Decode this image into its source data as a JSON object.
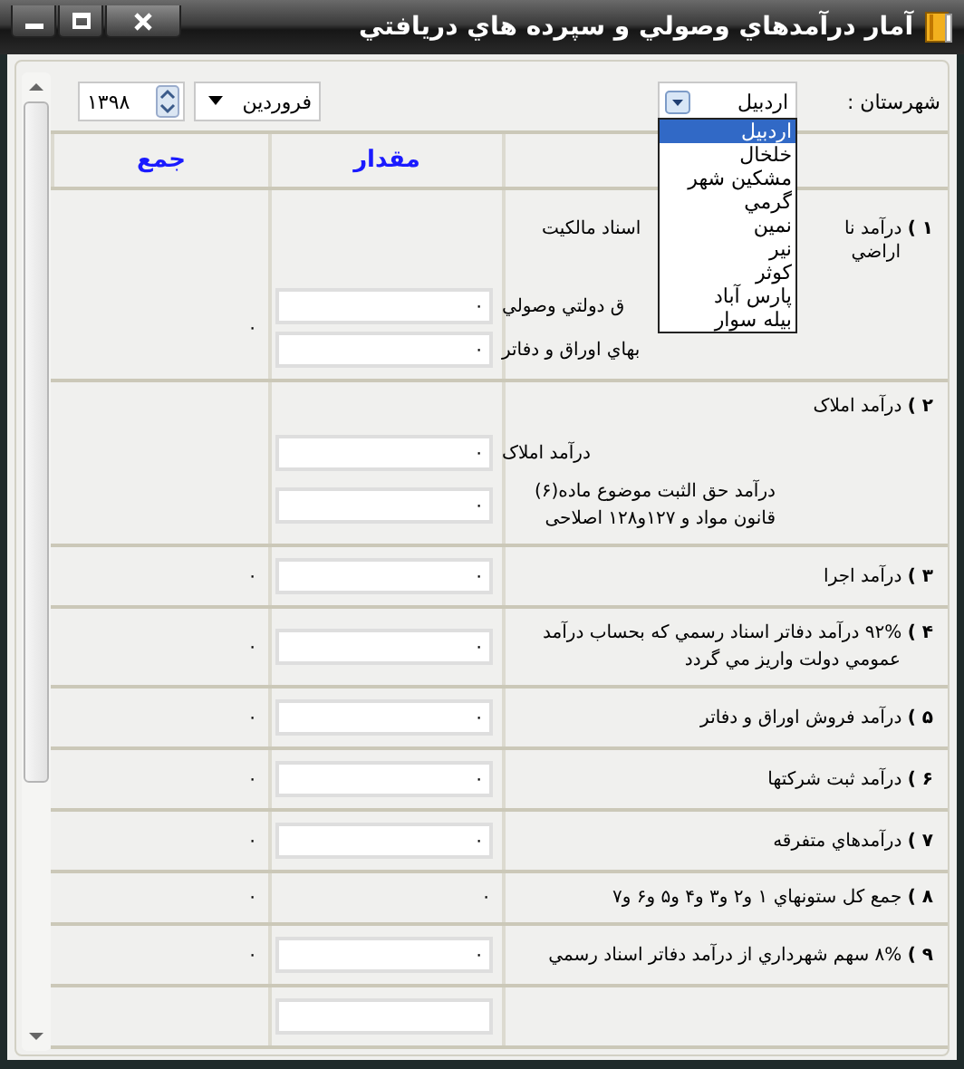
{
  "window": {
    "title": "آمار درآمدهاي وصولي و سپرده هاي دريافتي"
  },
  "filters": {
    "year": "۱۳۹۸",
    "month": "فروردین",
    "city_label": "شهرستان :",
    "city": {
      "value": "اردبیل",
      "expanded": true,
      "options": [
        {
          "label": "اردبیل",
          "selected": true
        },
        {
          "label": "خلخال",
          "selected": false
        },
        {
          "label": "مشکین شهر",
          "selected": false
        },
        {
          "label": "گرمي",
          "selected": false
        },
        {
          "label": "نمين",
          "selected": false
        },
        {
          "label": "نير",
          "selected": false
        },
        {
          "label": "کوثر",
          "selected": false
        },
        {
          "label": "پارس آباد",
          "selected": false
        },
        {
          "label": "بيله سوار",
          "selected": false
        }
      ]
    }
  },
  "columns": [
    "مقدار",
    "جمع"
  ],
  "rows": [
    {
      "title": "**۱ )** درآمد نا",
      "title_aside": "اسناد مالکیت",
      "title_cont": "اراضي",
      "entries": [
        {
          "kind": "field",
          "text": "ق دولتي وصولي",
          "value": "٠"
        },
        {
          "kind": "field",
          "text": "بهاي اوراق و دفاتر",
          "value": "٠"
        }
      ],
      "sum": "٠"
    },
    {
      "title": "**۲ )** درآمد املاک",
      "entries": [
        {
          "kind": "field",
          "text": "درآمد املاک",
          "value": "٠"
        },
        {
          "kind": "field",
          "text": "درآمد حق الثبت موضوع ماده(۶) قانون مواد و ۱۲۷و۱۲۸ اصلاحی",
          "value": "٠"
        }
      ]
    },
    {
      "title": "**۳ )** درآمد اجرا",
      "entries": [
        {
          "kind": "field",
          "value": "٠"
        }
      ],
      "sum": "٠"
    },
    {
      "title": "**۴ )** ۹۲% درآمد دفاتر اسناد رسمي که بحساب درآمد عمومي دولت واريز مي گردد",
      "entries": [
        {
          "kind": "field",
          "value": "٠"
        }
      ],
      "sum": "٠"
    },
    {
      "title": "**۵ )** درآمد فروش اوراق و دفاتر",
      "entries": [
        {
          "kind": "field",
          "value": "٠"
        }
      ],
      "sum": "٠"
    },
    {
      "title": "**۶ )** درآمد ثبت شرکتها",
      "entries": [
        {
          "kind": "field",
          "value": "٠"
        }
      ],
      "sum": "٠"
    },
    {
      "title": "**۷ )** درآمدهاي متفرقه",
      "entries": [
        {
          "kind": "field",
          "value": "٠"
        }
      ],
      "sum": "٠"
    },
    {
      "title": "**۸ )** جمع کل ستونهاي ۱ و۲ و۳ و۴ و۵ و۶ و۷",
      "entries": [
        {
          "kind": "value",
          "value": "٠"
        }
      ],
      "sum": "٠"
    },
    {
      "title": "**۹ )** ۸% سهم شهرداري از درآمد دفاتر اسناد رسمي",
      "entries": [
        {
          "kind": "field",
          "value": "٠"
        }
      ],
      "sum": "٠"
    },
    {
      "entries": [
        {
          "kind": "field"
        }
      ]
    }
  ]
}
